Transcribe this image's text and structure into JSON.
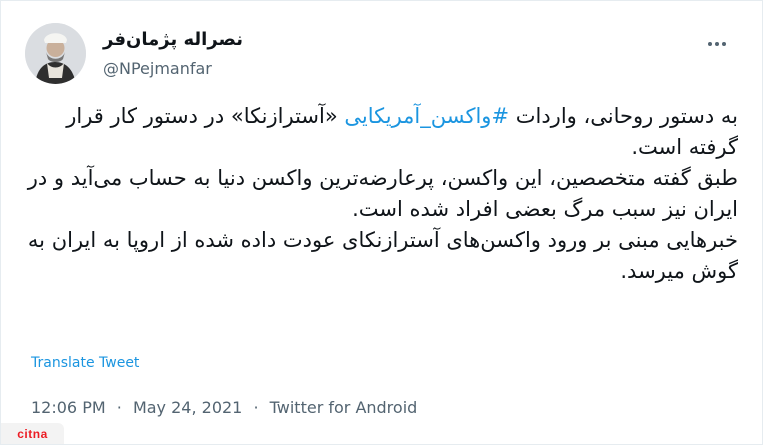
{
  "tweet": {
    "author": {
      "display_name": "نصراله پژمان‌فر",
      "handle": "@NPejmanfar",
      "verified": false
    },
    "text": {
      "line1_before": "به دستور روحانی، واردات ",
      "hashtag": "#واکسن_آمریکایی",
      "line1_after": " «آسترازنکا» در دستور کار قرار گرفته است.",
      "paragraph2": "طبق گفته متخصصین، این واکسن، پرعارضه‌ترین واکسن دنیا به حساب می‌آید و در ایران نیز سبب مرگ بعضی افراد شده است.",
      "paragraph3": "خبرهایی مبنی بر ورود واکسن‌های آسترازنکای عودت داده شده از اروپا به ایران به گوش میرسد."
    },
    "translate_label": "Translate Tweet",
    "time": "12:06 PM",
    "date": "May 24, 2021",
    "source": "Twitter for Android",
    "separator": "·"
  },
  "watermark": {
    "text": "citna"
  },
  "colors": {
    "link": "#1b95e0",
    "text": "#0f1419",
    "muted": "#536471",
    "border": "#e6ecf0",
    "watermark": "#ec1c24"
  },
  "icons": {
    "more": "more-dots-icon",
    "avatar": "profile-avatar"
  }
}
